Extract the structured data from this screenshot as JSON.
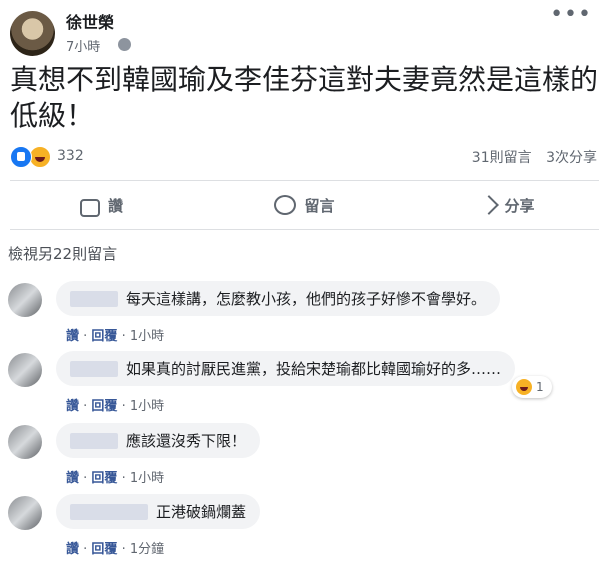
{
  "post": {
    "author": "徐世榮",
    "time": "7小時",
    "text": "真想不到韓國瑜及李佳芬這對夫妻竟然是這樣的低級！",
    "reaction_count": "332",
    "comments_count": "31則留言",
    "shares_count": "3次分享"
  },
  "actions": {
    "like": "讚",
    "comment": "留言",
    "share": "分享"
  },
  "comments_header": "檢視另22則留言",
  "comments": [
    {
      "text": "每天這樣講，怎麼教小孩，他們的孩子好慘不會學好。",
      "like": "讚",
      "reply": "回覆",
      "time": "1小時"
    },
    {
      "text": "如果真的討厭民進黨，投給宋楚瑜都比韓國瑜好的多……",
      "like": "讚",
      "reply": "回覆",
      "time": "1小時",
      "reaction_count": "1"
    },
    {
      "text": "應該還沒秀下限！",
      "like": "讚",
      "reply": "回覆",
      "time": "1小時"
    },
    {
      "text": "正港破鍋爛蓋",
      "like": "讚",
      "reply": "回覆",
      "time": "1分鐘"
    }
  ],
  "icons": {
    "more": "more-options-icon",
    "globe": "globe-icon",
    "like": "thumb-up-icon",
    "comment": "comment-bubble-icon",
    "share": "share-arrow-icon",
    "reaction_like": "like-reaction-icon",
    "reaction_haha": "haha-reaction-icon"
  }
}
